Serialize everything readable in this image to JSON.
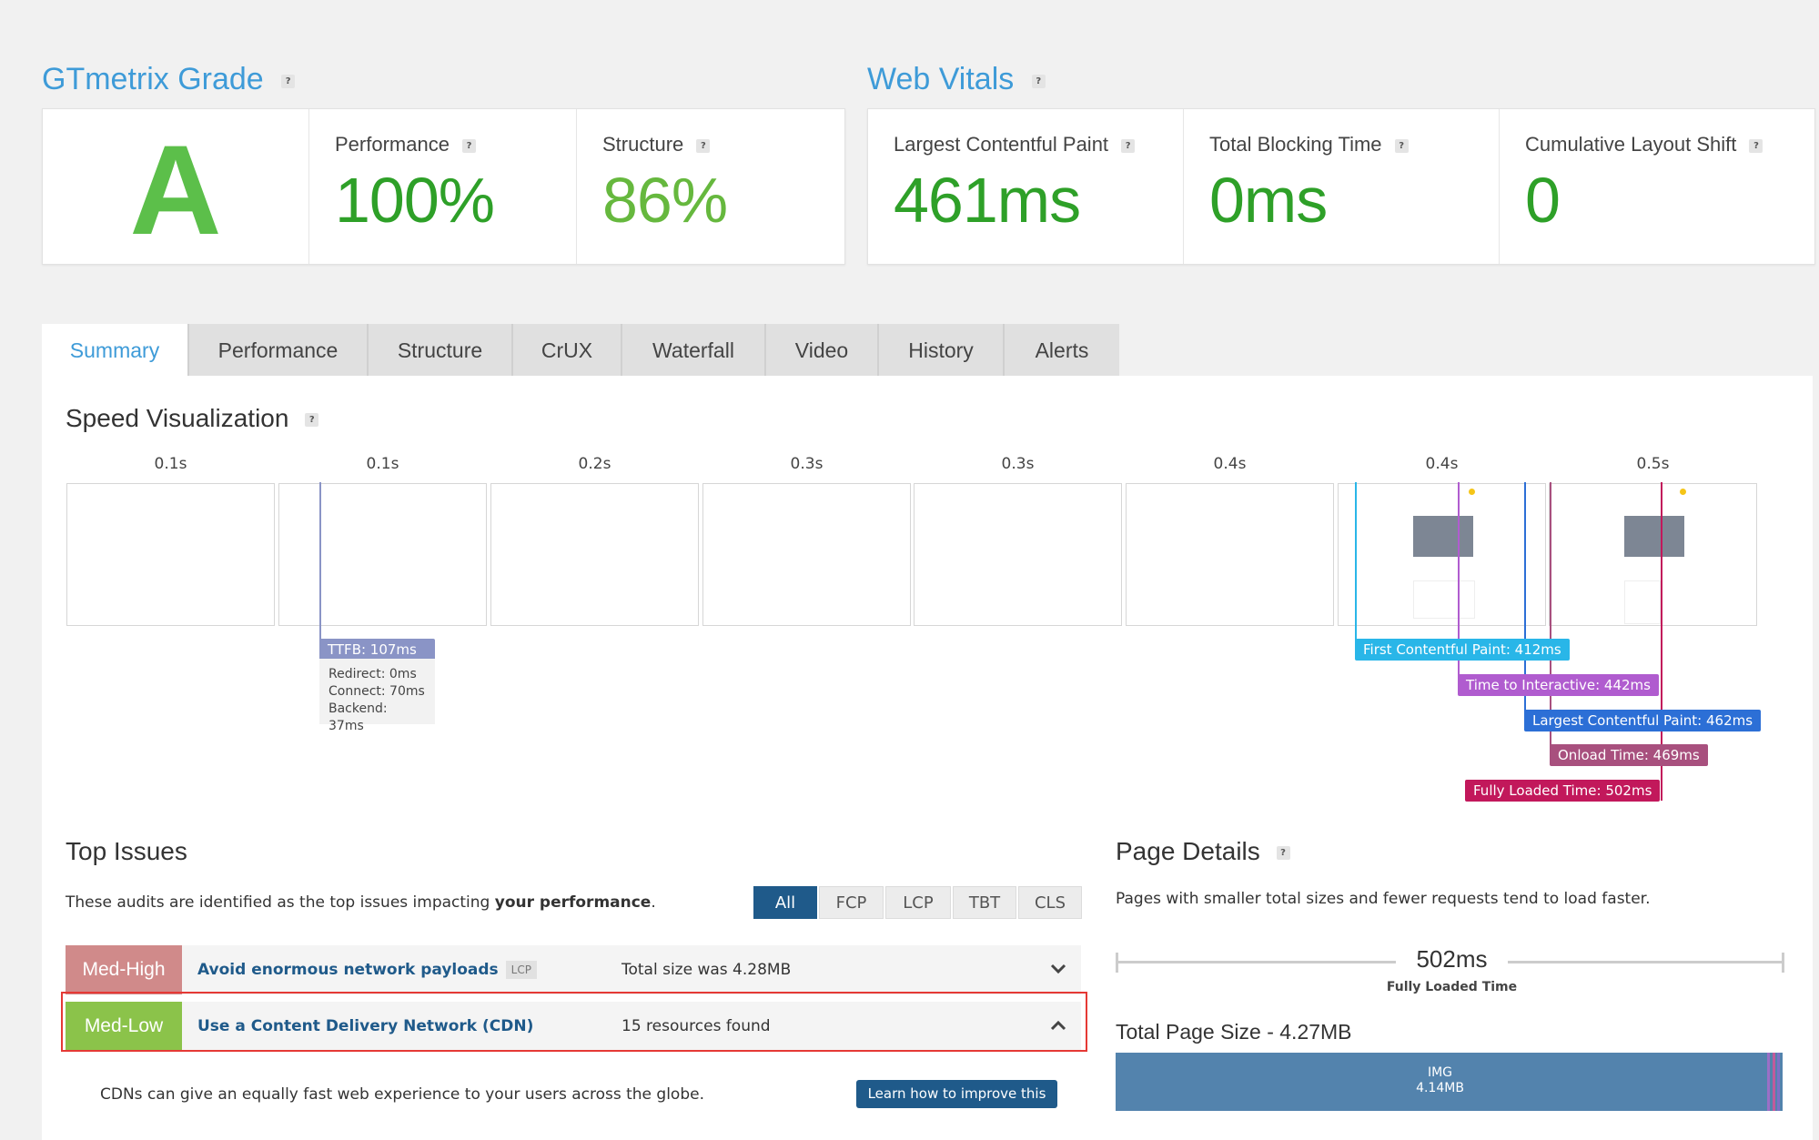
{
  "grade_section": {
    "title": "GTmetrix Grade",
    "help": "?",
    "grade": "A",
    "metrics": [
      {
        "label": "Performance",
        "value": "100%",
        "color": "#2ea028"
      },
      {
        "label": "Structure",
        "value": "86%",
        "color": "#66b83e"
      }
    ]
  },
  "vitals_section": {
    "title": "Web Vitals",
    "help": "?",
    "metrics": [
      {
        "label": "Largest Contentful Paint",
        "value": "461ms"
      },
      {
        "label": "Total Blocking Time",
        "value": "0ms"
      },
      {
        "label": "Cumulative Layout Shift",
        "value": "0"
      }
    ]
  },
  "tabs": [
    "Summary",
    "Performance",
    "Structure",
    "CrUX",
    "Waterfall",
    "Video",
    "History",
    "Alerts"
  ],
  "speed": {
    "title": "Speed Visualization",
    "frame_times": [
      "0.1s",
      "0.1s",
      "0.2s",
      "0.3s",
      "0.3s",
      "0.4s",
      "0.4s",
      "0.5s"
    ],
    "ttfb": {
      "label": "TTFB: 107ms",
      "redirect": "Redirect: 0ms",
      "connect": "Connect: 70ms",
      "backend": "Backend: 37ms",
      "color": "#8a94c6"
    },
    "markers": [
      {
        "label": "First Contentful Paint: 412ms",
        "color": "#29b6e8"
      },
      {
        "label": "Time to Interactive: 442ms",
        "color": "#b05ccf"
      },
      {
        "label": "Largest Contentful Paint: 462ms",
        "color": "#2c6fd6"
      },
      {
        "label": "Onload Time: 469ms",
        "color": "#a8507e"
      },
      {
        "label": "Fully Loaded Time: 502ms",
        "color": "#c2185b"
      }
    ]
  },
  "top_issues": {
    "title": "Top Issues",
    "desc_prefix": "These audits are identified as the top issues impacting ",
    "desc_bold": "your performance",
    "desc_suffix": ".",
    "filters": [
      "All",
      "FCP",
      "LCP",
      "TBT",
      "CLS"
    ],
    "issues": [
      {
        "severity": "Med-High",
        "color": "#d08a8a",
        "name": "Avoid enormous network payloads",
        "tag": "LCP",
        "detail": "Total size was 4.28MB",
        "chevron": "⌄"
      },
      {
        "severity": "Med-Low",
        "color": "#8bc34a",
        "name": "Use a Content Delivery Network (CDN)",
        "tag": "",
        "detail": "15 resources found",
        "chevron": "⌃"
      }
    ],
    "expanded_text": "CDNs can give an equally fast web experience to your users across the globe.",
    "learn_button": "Learn how to improve this"
  },
  "page_details": {
    "title": "Page Details",
    "help": "?",
    "desc": "Pages with smaller total sizes and fewer requests tend to load faster.",
    "loaded_value": "502ms",
    "loaded_label": "Fully Loaded Time",
    "total_size": "Total Page Size - 4.27MB",
    "bar_type": "IMG",
    "bar_size": "4.14MB"
  }
}
